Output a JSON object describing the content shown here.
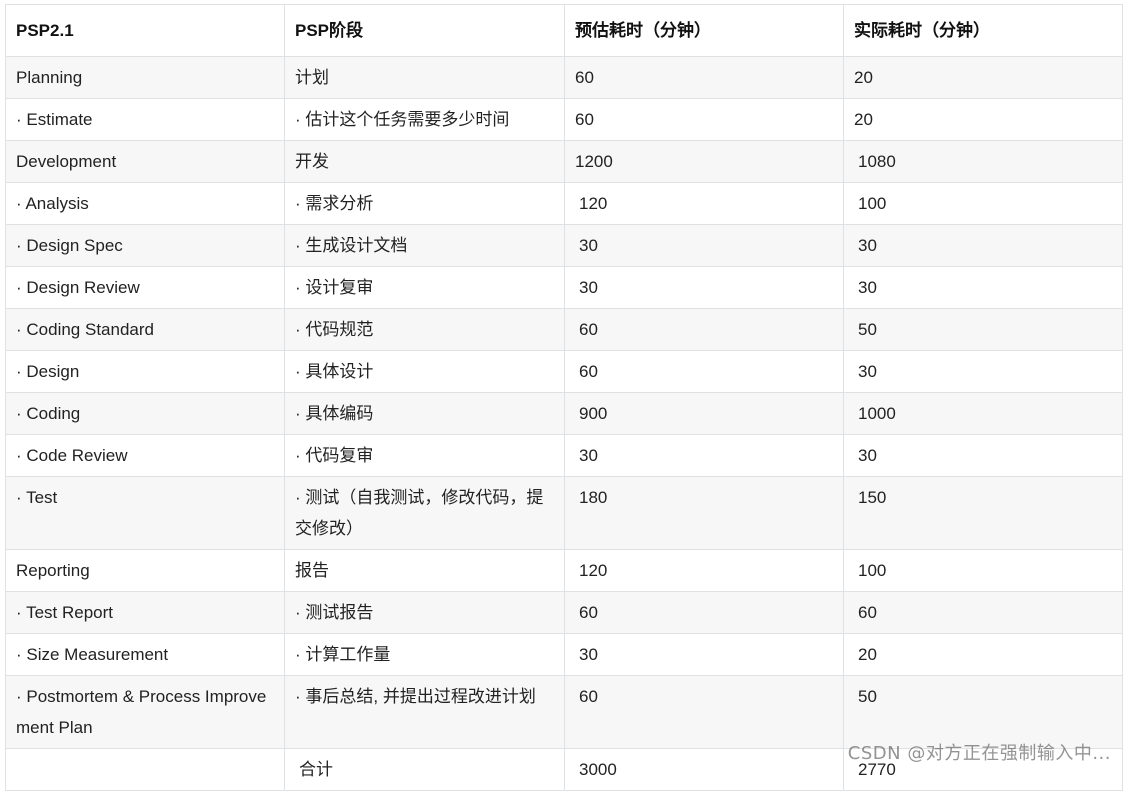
{
  "table": {
    "headers": [
      "PSP2.1",
      "PSP阶段",
      "预估耗时（分钟）",
      "实际耗时（分钟）"
    ],
    "rows": [
      [
        "Planning",
        "计划",
        "60",
        "20"
      ],
      [
        "· Estimate",
        "· 估计这个任务需要多少时间",
        "60",
        "20"
      ],
      [
        "Development",
        "开发",
        "1200",
        "1080"
      ],
      [
        "· Analysis",
        "· 需求分析",
        "120",
        "100"
      ],
      [
        "· Design Spec",
        "· 生成设计文档",
        "30",
        "30"
      ],
      [
        "· Design Review",
        "· 设计复审",
        "30",
        "30"
      ],
      [
        "· Coding Standard",
        "· 代码规范",
        "60",
        "50"
      ],
      [
        "· Design",
        "· 具体设计",
        "60",
        "30"
      ],
      [
        "· Coding",
        "· 具体编码",
        "900",
        "1000"
      ],
      [
        "· Code Review",
        "· 代码复审",
        "30",
        "30"
      ],
      [
        "· Test",
        "· 测试（自我测试，修改代码，提交修改）",
        "180",
        "150"
      ],
      [
        "Reporting",
        "报告",
        "120",
        "100"
      ],
      [
        "· Test Report",
        "· 测试报告",
        "60",
        "60"
      ],
      [
        "· Size Measurement",
        "· 计算工作量",
        "30",
        "20"
      ],
      [
        "· Postmortem & Process Improvement Plan",
        "· 事后总结, 并提出过程改进计划",
        "60",
        "50"
      ],
      [
        "",
        "合计",
        "3000",
        "2770"
      ]
    ]
  },
  "watermark": "CSDN @对方正在强制输入中..."
}
